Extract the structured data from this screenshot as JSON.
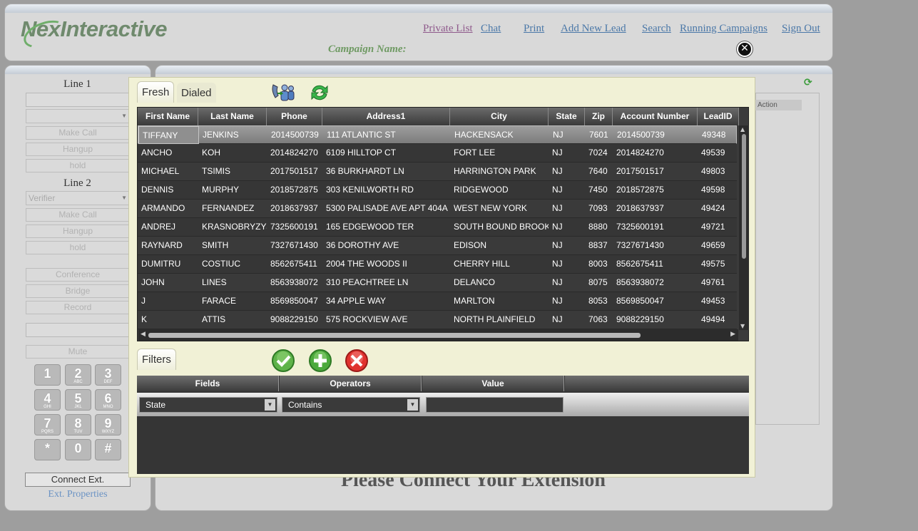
{
  "header": {
    "logo_text": "NexInteractive",
    "campaign_label": "Campaign Name:",
    "nav": [
      "Private List",
      "Chat",
      "Print",
      "Add New Lead",
      "Search",
      "Running Campaigns",
      "Sign Out"
    ]
  },
  "sidebar": {
    "line1_label": "Line 1",
    "line2_label": "Line 2",
    "make_call": "Make Call",
    "hangup": "Hangup",
    "hold": "hold",
    "verifier": "Verifier",
    "conference": "Conference",
    "bridge": "Bridge",
    "record": "Record",
    "mute": "Mute",
    "connect_ext": "Connect Ext.",
    "ext_properties": "Ext. Properties",
    "keypad": [
      {
        "d": "1",
        "l": ""
      },
      {
        "d": "2",
        "l": "ABC"
      },
      {
        "d": "3",
        "l": "DEF"
      },
      {
        "d": "4",
        "l": "GHI"
      },
      {
        "d": "5",
        "l": "JKL"
      },
      {
        "d": "6",
        "l": "MNO"
      },
      {
        "d": "7",
        "l": "PQRS"
      },
      {
        "d": "8",
        "l": "TUV"
      },
      {
        "d": "9",
        "l": "WXYZ"
      },
      {
        "d": "*",
        "l": ""
      },
      {
        "d": "0",
        "l": ""
      },
      {
        "d": "#",
        "l": ""
      }
    ]
  },
  "main": {
    "connect_message": "Please Connect Your Extension",
    "action_header": "Action"
  },
  "modal": {
    "tabs": [
      "Fresh",
      "Dialed"
    ],
    "active_tab": "Fresh",
    "columns": [
      "First Name",
      "Last Name",
      "Phone",
      "Address1",
      "City",
      "State",
      "Zip",
      "Account Number",
      "LeadID"
    ],
    "rows": [
      [
        "TIFFANY",
        "JENKINS",
        "2014500739",
        "111 ATLANTIC ST",
        "HACKENSACK",
        "NJ",
        "7601",
        "2014500739",
        "49348"
      ],
      [
        "ANCHO",
        "KOH",
        "2014824270",
        "6109 HILLTOP CT",
        "FORT LEE",
        "NJ",
        "7024",
        "2014824270",
        "49539"
      ],
      [
        "MICHAEL",
        "TSIMIS",
        "2017501517",
        "36 BURKHARDT LN",
        "HARRINGTON PARK",
        "NJ",
        "7640",
        "2017501517",
        "49803"
      ],
      [
        "DENNIS",
        "MURPHY",
        "2018572875",
        "303 KENILWORTH RD",
        "RIDGEWOOD",
        "NJ",
        "7450",
        "2018572875",
        "49598"
      ],
      [
        "ARMANDO",
        "FERNANDEZ",
        "2018637937",
        "5300 PALISADE AVE APT 404A",
        "WEST NEW YORK",
        "NJ",
        "7093",
        "2018637937",
        "49424"
      ],
      [
        "ANDREJ",
        "KRASNOBRYZYJ",
        "7325600191",
        "165 EDGEWOOD TER",
        "SOUTH BOUND BROOK",
        "NJ",
        "8880",
        "7325600191",
        "49721"
      ],
      [
        "RAYNARD",
        "SMITH",
        "7327671430",
        "36 DOROTHY AVE",
        "EDISON",
        "NJ",
        "8837",
        "7327671430",
        "49659"
      ],
      [
        "DUMITRU",
        "COSTIUC",
        "8562675411",
        "2004 THE WOODS II",
        "CHERRY HILL",
        "NJ",
        "8003",
        "8562675411",
        "49575"
      ],
      [
        "JOHN",
        "LINES",
        "8563938072",
        "310 PEACHTREE LN",
        "DELANCO",
        "NJ",
        "8075",
        "8563938072",
        "49761"
      ],
      [
        "J",
        "FARACE",
        "8569850047",
        "34 APPLE WAY",
        "MARLTON",
        "NJ",
        "8053",
        "8569850047",
        "49453"
      ],
      [
        "K",
        "ATTIS",
        "9088229150",
        "575 ROCKVIEW AVE",
        "NORTH PLAINFIELD",
        "NJ",
        "7063",
        "9088229150",
        "49494"
      ]
    ],
    "filters": {
      "tab": "Filters",
      "columns": [
        "Fields",
        "Operators",
        "Value",
        ""
      ],
      "field_value": "State",
      "operator_value": "Contains",
      "value": ""
    }
  }
}
